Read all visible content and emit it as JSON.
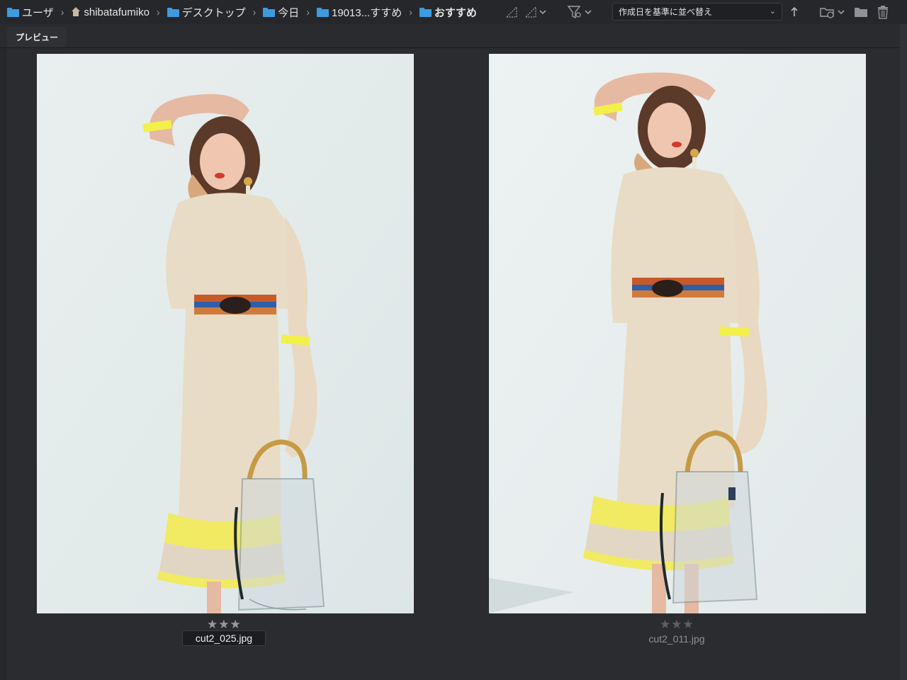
{
  "breadcrumb": [
    {
      "label": "ユーザ",
      "icon": "folder-icon"
    },
    {
      "label": "shibatafumiko",
      "icon": "home-icon"
    },
    {
      "label": "デスクトップ",
      "icon": "folder-icon"
    },
    {
      "label": "今日",
      "icon": "folder-icon"
    },
    {
      "label": "19013...すすめ",
      "icon": "folder-icon"
    },
    {
      "label": "おすすめ",
      "icon": "folder-icon"
    }
  ],
  "toolbar": {
    "sort_label": "作成日を基準に並べ替え",
    "icons": [
      "stack-icon",
      "stack-chevron-icon",
      "filter-icon",
      "sort-direction-icon",
      "folder-options-icon",
      "new-folder-icon",
      "trash-icon"
    ]
  },
  "panel": {
    "tab_label": "プレビュー"
  },
  "thumbnails": [
    {
      "filename": "cut2_025.jpg",
      "stars": "★★★",
      "rating": 3,
      "selected": true
    },
    {
      "filename": "cut2_011.jpg",
      "stars": "★★★",
      "rating": 3,
      "selected": false
    }
  ],
  "colors": {
    "accent_folder": "#3d9be0",
    "background": "#2b2c30",
    "selected_label_bg": "#1c1d20"
  }
}
